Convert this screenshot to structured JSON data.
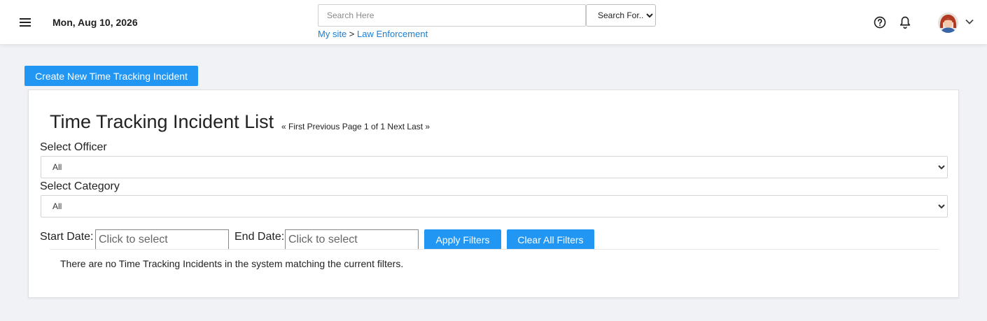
{
  "header": {
    "date": "Mon, Aug 10, 2026",
    "search_placeholder": "Search Here",
    "search_for": "Search For...",
    "breadcrumb": {
      "home": "My site",
      "separator": ">",
      "current": "Law Enforcement"
    },
    "icons": [
      "menu-icon",
      "help-icon",
      "bell-icon",
      "avatar",
      "chevron-down-icon"
    ]
  },
  "toolbar": {
    "create_label": "Create New Time Tracking Incident"
  },
  "list": {
    "title": "Time Tracking Incident List",
    "pager": "« First Previous Page 1 of 1 Next Last »",
    "officer_label": "Select Officer",
    "officer_value": "All",
    "category_label": "Select Category",
    "category_value": "All",
    "start_label": "Start Date:",
    "start_placeholder": "Click to select",
    "end_label": "End Date:",
    "end_placeholder": "Click to select",
    "apply_label": "Apply Filters",
    "clear_label": "Clear All Filters",
    "empty_message": "There are no Time Tracking Incidents in the system matching the current filters."
  },
  "colors": {
    "accent": "#2196f3",
    "link": "#1a7fd6",
    "page_bg": "#f1f2f6"
  }
}
